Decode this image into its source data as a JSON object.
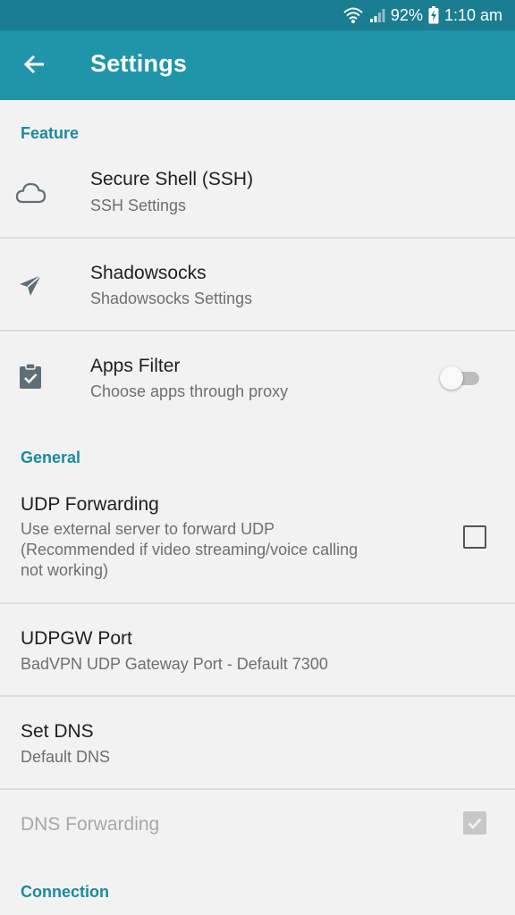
{
  "status_bar": {
    "battery": "92%",
    "time": "1:10 am",
    "icons": [
      "wifi-icon",
      "signal-icon",
      "battery-charging-icon"
    ]
  },
  "app_bar": {
    "title": "Settings",
    "back_icon": "arrow-back-icon"
  },
  "sections": {
    "feature": "Feature",
    "general": "General",
    "connection": "Connection"
  },
  "items": {
    "ssh": {
      "title": "Secure Shell (SSH)",
      "summary": "SSH Settings",
      "icon": "cloud-icon"
    },
    "shadowsocks": {
      "title": "Shadowsocks",
      "summary": "Shadowsocks Settings",
      "icon": "paper-plane-icon"
    },
    "apps_filter": {
      "title": "Apps Filter",
      "summary": "Choose apps through proxy",
      "icon": "clipboard-check-icon",
      "enabled": false
    },
    "udp_forwarding": {
      "title": "UDP Forwarding",
      "summary": "Use external server to forward UDP (Recommended if video streaming/voice calling not working)",
      "checked": false
    },
    "udpgw_port": {
      "title": "UDPGW Port",
      "summary": "BadVPN UDP Gateway Port - Default 7300"
    },
    "set_dns": {
      "title": "Set DNS",
      "summary": "Default DNS"
    },
    "dns_forwarding": {
      "title": "DNS Forwarding",
      "checked": true,
      "disabled": true
    }
  },
  "colors": {
    "status_bar": "#1a7d91",
    "app_bar": "#2095aa",
    "section_header": "#1b8a9e",
    "background": "#f2f2f2"
  }
}
